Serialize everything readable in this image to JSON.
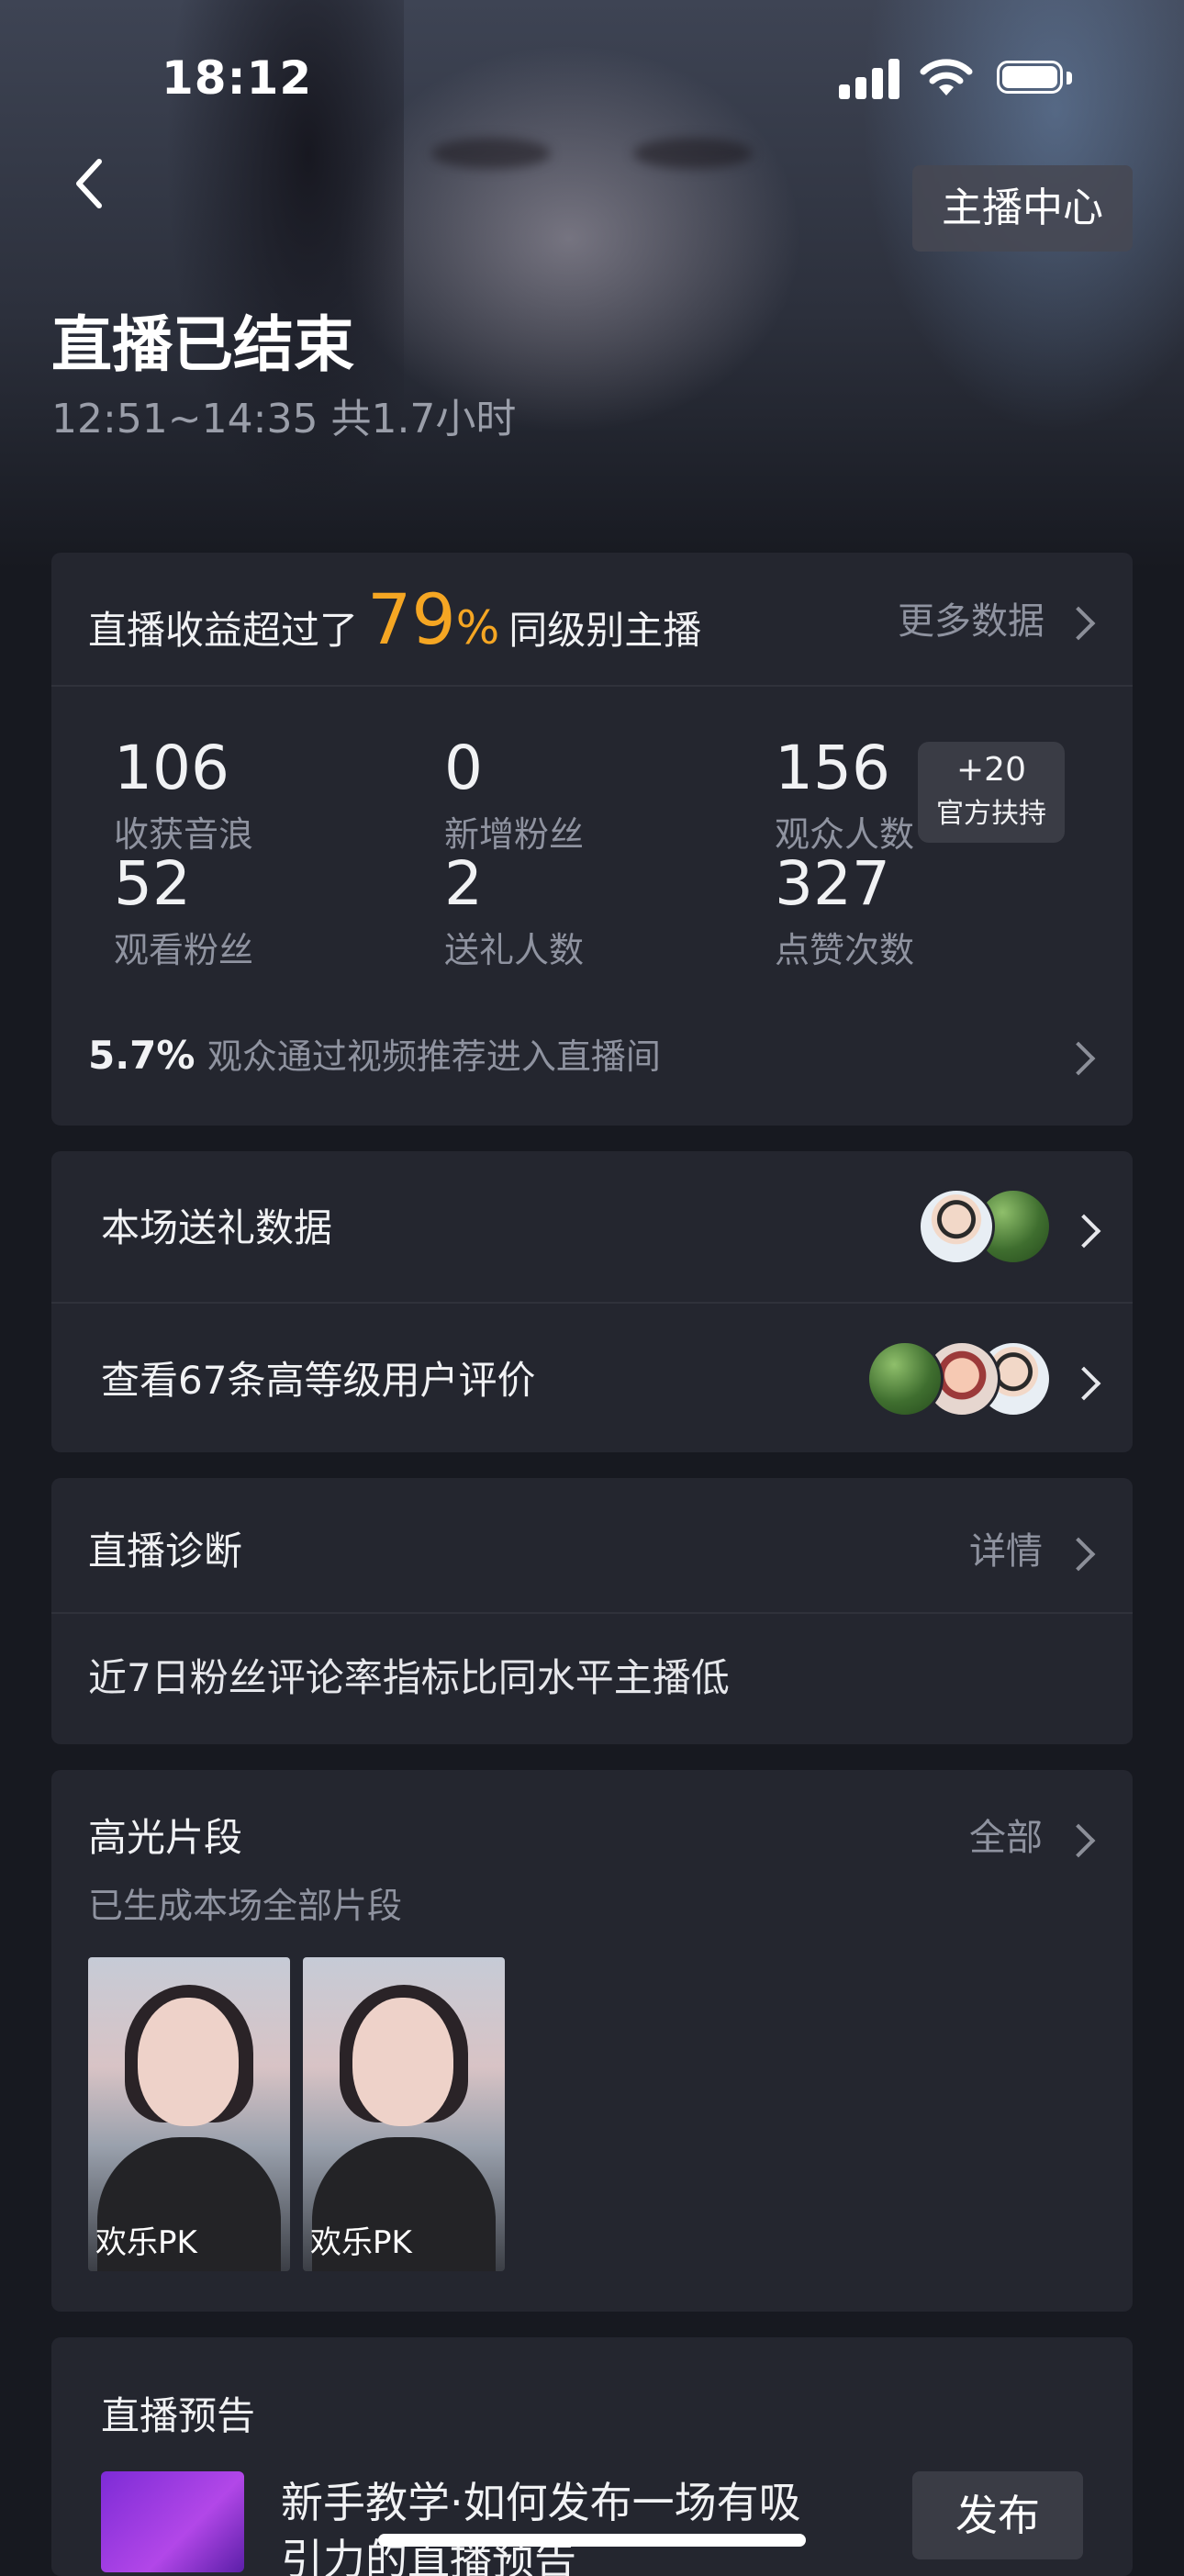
{
  "status_bar": {
    "time": "18:12"
  },
  "nav": {
    "anchor_center": "主播中心"
  },
  "header": {
    "title": "直播已结束",
    "subtitle": "12:51~14:35 共1.7小时"
  },
  "stats_card": {
    "rank_prefix": "直播收益超过了",
    "rank_value": "79",
    "rank_unit": "%",
    "rank_suffix": "同级别主播",
    "more_data": "更多数据",
    "stats": [
      {
        "value": "106",
        "label": "收获音浪"
      },
      {
        "value": "0",
        "label": "新增粉丝"
      },
      {
        "value": "156",
        "label": "观众人数"
      },
      {
        "value": "52",
        "label": "观看粉丝"
      },
      {
        "value": "2",
        "label": "送礼人数"
      },
      {
        "value": "327",
        "label": "点赞次数"
      }
    ],
    "badge": {
      "line1": "+20",
      "line2": "官方扶持"
    },
    "recommend_value": "5.7%",
    "recommend_text": "观众通过视频推荐进入直播间"
  },
  "gift_card": {
    "gift_data": "本场送礼数据",
    "reviews": "查看67条高等级用户评价"
  },
  "diagnosis": {
    "title": "直播诊断",
    "detail": "详情",
    "text": "近7日粉丝评论率指标比同水平主播低"
  },
  "highlights": {
    "title": "高光片段",
    "all": "全部",
    "subtitle": "已生成本场全部片段",
    "clips": [
      {
        "caption": "欢乐PK"
      },
      {
        "caption": "欢乐PK"
      }
    ]
  },
  "preview": {
    "title": "直播预告",
    "text_line1": "新手教学·如何发布一场有吸",
    "text_line2": "引力的直播预告",
    "publish": "发布"
  }
}
